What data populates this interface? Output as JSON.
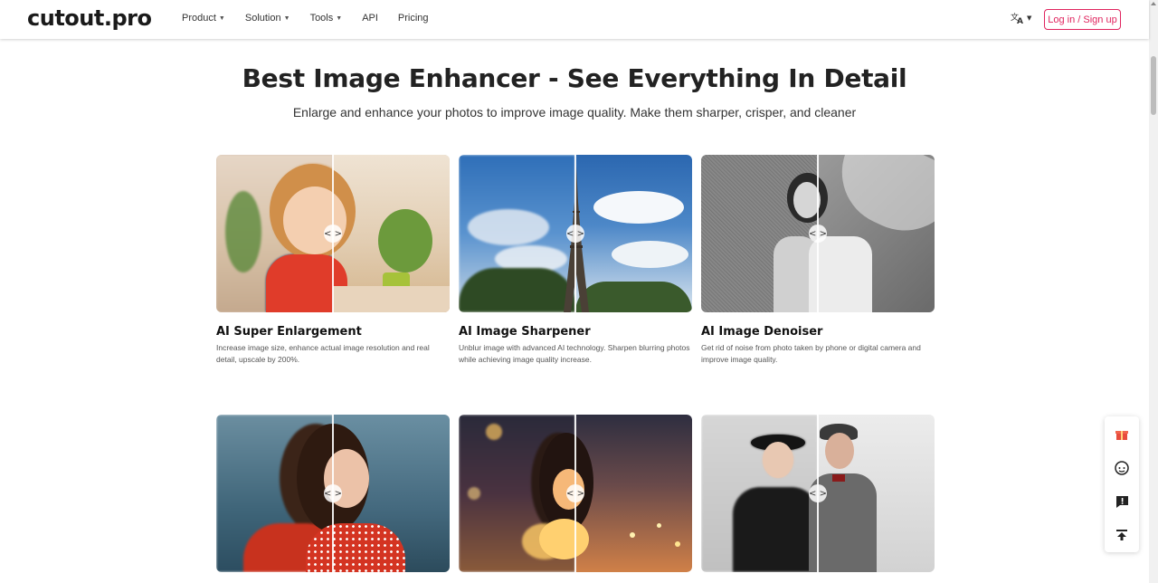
{
  "header": {
    "logo": "cutout.pro",
    "nav": [
      {
        "label": "Product",
        "has_dropdown": true
      },
      {
        "label": "Solution",
        "has_dropdown": true
      },
      {
        "label": "Tools",
        "has_dropdown": true
      },
      {
        "label": "API",
        "has_dropdown": false
      },
      {
        "label": "Pricing",
        "has_dropdown": false
      }
    ],
    "language_icon": "translate-icon",
    "login_label": "Log in / Sign up"
  },
  "hero": {
    "title": "Best Image Enhancer - See Everything In Detail",
    "subtitle": "Enlarge and enhance your photos to improve image quality. Make them sharper, crisper, and cleaner"
  },
  "cards": [
    {
      "title": "AI Super Enlargement",
      "description": "Increase image size, enhance actual image resolution and real detail, upscale by 200%.",
      "image": "child-portrait"
    },
    {
      "title": "AI Image Sharpener",
      "description": "Unblur image with advanced AI technology. Sharpen blurring photos while achieving image quality increase.",
      "image": "eiffel-tower"
    },
    {
      "title": "AI Image Denoiser",
      "description": "Get rid of noise from photo taken by phone or digital camera and improve image quality.",
      "image": "woman-umbrella-bw"
    },
    {
      "title": "",
      "description": "",
      "image": "woman-red-dress"
    },
    {
      "title": "",
      "description": "",
      "image": "woman-fairy-lights"
    },
    {
      "title": "",
      "description": "",
      "image": "elderly-couple"
    }
  ],
  "compare_handle": "<  >",
  "floating_toolbar": [
    "gift-icon",
    "support-avatar-icon",
    "feedback-icon",
    "back-to-top-icon"
  ],
  "colors": {
    "accent": "#e0245e",
    "text": "#222222"
  }
}
